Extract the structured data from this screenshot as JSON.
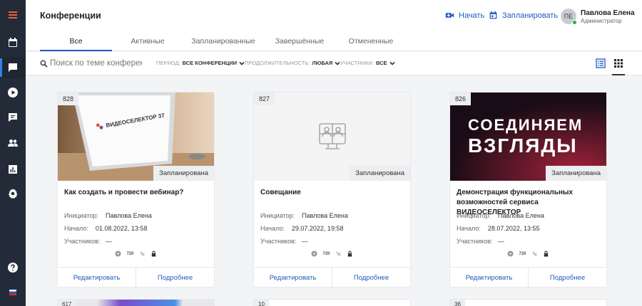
{
  "header": {
    "title": "Конференции",
    "start_label": "Начать",
    "schedule_label": "Запланировать",
    "user": {
      "initials": "ПЕ",
      "name": "Павлова Елена",
      "role": "Администратор"
    }
  },
  "tabs": [
    {
      "label": "Все",
      "active": true
    },
    {
      "label": "Активные"
    },
    {
      "label": "Запланированные"
    },
    {
      "label": "Завершённые"
    },
    {
      "label": "Отмененные"
    }
  ],
  "filters": {
    "search_placeholder": "Поиск по теме конференции",
    "period_label": "ПЕРИОД:",
    "period_value": "ВСЕ КОНФЕРЕНЦИИ",
    "duration_label": "ПРОДОЛЖИТЕЛЬНОСТЬ:",
    "duration_value": "ЛЮБАЯ",
    "participants_label": "УЧАСТНИКИ:",
    "participants_value": "ВСЕ"
  },
  "card_labels": {
    "initiator": "Инициатор:",
    "start": "Начало:",
    "participants": "Участников:",
    "edit": "Редактировать",
    "more": "Подробнее",
    "quality": "720"
  },
  "cards": [
    {
      "id": "828",
      "status": "Запланирована",
      "title": "Как создать и провести вебинар?",
      "initiator": "Павлова Елена",
      "start": "01.08.2022, 13:58",
      "participants": "—",
      "logo_text": "ВИДЕОСЕЛЕКТОР 37"
    },
    {
      "id": "827",
      "status": "Запланирована",
      "title": "Совещание",
      "initiator": "Павлова Елена",
      "start": "29.07.2022, 19:58",
      "participants": "—"
    },
    {
      "id": "826",
      "status": "Запланирована",
      "title": "Демонстрация функциональных возможностей сервиса ВИДЕОСЕЛЕКТОР",
      "initiator": "Павлова Елена",
      "start": "28.07.2022, 13:55",
      "participants": "—",
      "banner_line1": "СОЕДИНЯЕМ",
      "banner_line2": "ВЗГЛЯДЫ"
    }
  ],
  "more_cards": [
    {
      "id": "617"
    },
    {
      "id": "10"
    },
    {
      "id": "36"
    }
  ],
  "colors": {
    "sidebar": "#232b38",
    "accent": "#1f5bbf",
    "online": "#22b14c"
  }
}
